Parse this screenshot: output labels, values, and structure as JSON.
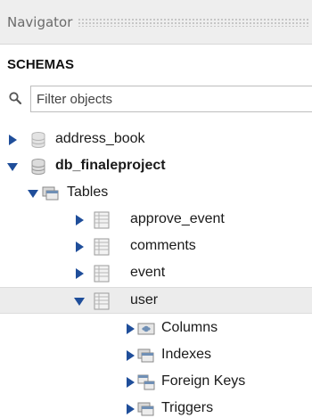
{
  "navigator": {
    "title": "Navigator",
    "section_label": "SCHEMAS",
    "filter_placeholder": "Filter objects"
  },
  "tree": {
    "schemas": [
      {
        "label": "address_book",
        "expanded": false,
        "active": false
      },
      {
        "label": "db_finaleproject",
        "expanded": true,
        "active": true,
        "tables_label": "Tables",
        "tables": [
          {
            "label": "approve_event",
            "expanded": false
          },
          {
            "label": "comments",
            "expanded": false
          },
          {
            "label": "event",
            "expanded": false
          },
          {
            "label": "user",
            "expanded": true,
            "selected": true,
            "children": [
              {
                "label": "Columns",
                "icon": "columns-folder-icon"
              },
              {
                "label": "Indexes",
                "icon": "indexes-folder-icon"
              },
              {
                "label": "Foreign Keys",
                "icon": "foreign-keys-folder-icon"
              },
              {
                "label": "Triggers",
                "icon": "triggers-folder-icon"
              }
            ]
          }
        ]
      }
    ]
  },
  "colors": {
    "arrow": "#1f4e9a",
    "selected_row_bg": "#ececec",
    "titlebar_bg": "#eeeeee"
  }
}
